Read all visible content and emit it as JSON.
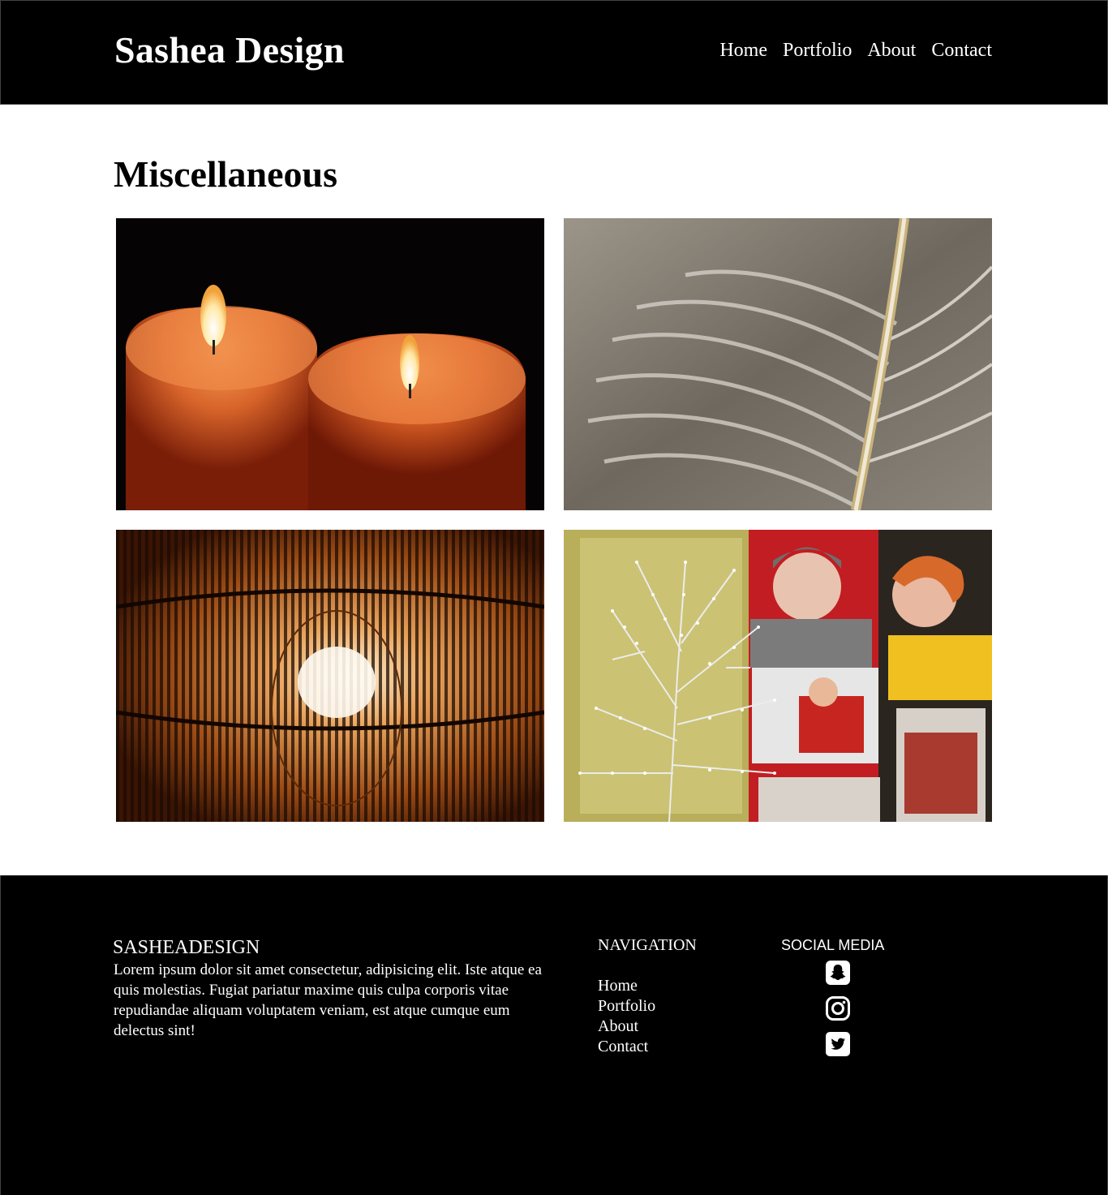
{
  "header": {
    "brand": "Sashea Design",
    "nav": [
      "Home",
      "Portfolio",
      "About",
      "Contact"
    ]
  },
  "main": {
    "title": "Miscellaneous",
    "photos": [
      "candles-photo",
      "silver-leaf-photo",
      "bamboo-lamp-photo",
      "light-tree-posters-photo"
    ]
  },
  "footer": {
    "brand": "SASHEADESIGN",
    "text": "Lorem ipsum dolor sit amet consectetur, adipisicing elit. Iste atque ea quis molestias. Fugiat pariatur maxime quis culpa corporis vitae repudiandae aliquam voluptatem veniam, est atque cumque eum delectus sint!",
    "nav_title": "NAVIGATION",
    "nav": [
      "Home",
      "Portfolio",
      "About",
      "Contact"
    ],
    "social_title": "SOCIAL MEDIA",
    "social_icons": [
      "snapchat-icon",
      "instagram-icon",
      "twitter-icon"
    ]
  },
  "colors": {
    "background": "#ffffff",
    "header_footer_bg": "#000000",
    "text_on_dark": "#ffffff"
  }
}
